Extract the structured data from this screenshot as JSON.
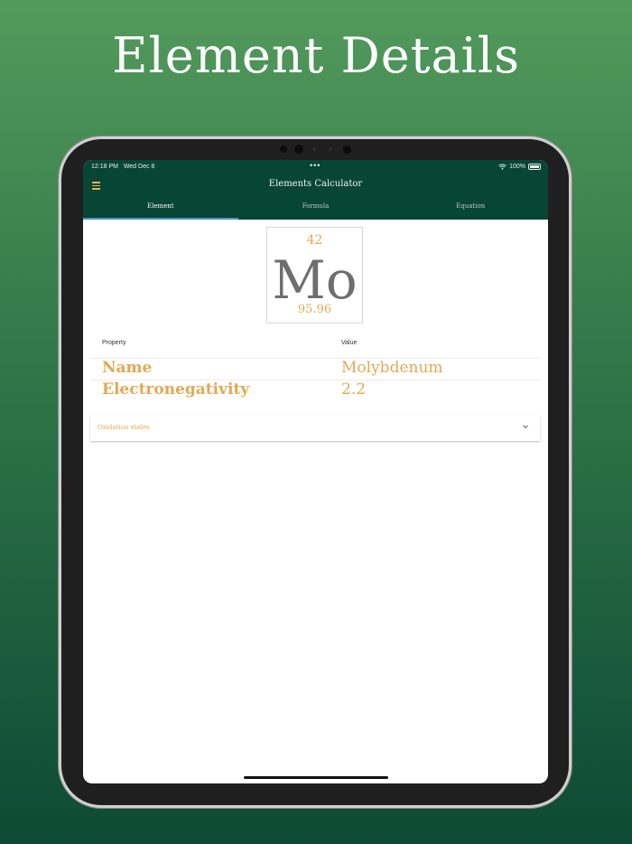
{
  "headline": "Element Details",
  "status_bar": {
    "time": "12:18 PM",
    "date": "Wed Dec 8",
    "dots": "•••",
    "battery": "100%"
  },
  "app_bar": {
    "title": "Elements Calculator"
  },
  "tabs": [
    {
      "label": "Element",
      "active": true
    },
    {
      "label": "Formula",
      "active": false
    },
    {
      "label": "Equation",
      "active": false
    }
  ],
  "element_tile": {
    "atomic_number": "42",
    "symbol": "Mo",
    "atomic_mass": "95.96"
  },
  "table": {
    "headers": {
      "property": "Property",
      "value": "Value"
    },
    "rows": [
      {
        "property": "Name",
        "value": "Molybdenum"
      },
      {
        "property": "Electronegativity",
        "value": "2.2"
      }
    ]
  },
  "accordion": {
    "label": "Oxidation states"
  },
  "colors": {
    "app_bar": "#074535",
    "accent": "#e2a955",
    "tab_indicator": "#4a90d9",
    "symbol": "#6e6e6e"
  },
  "icons": [
    "menu-icon",
    "wifi-icon",
    "battery-icon",
    "chevron-down-icon"
  ]
}
